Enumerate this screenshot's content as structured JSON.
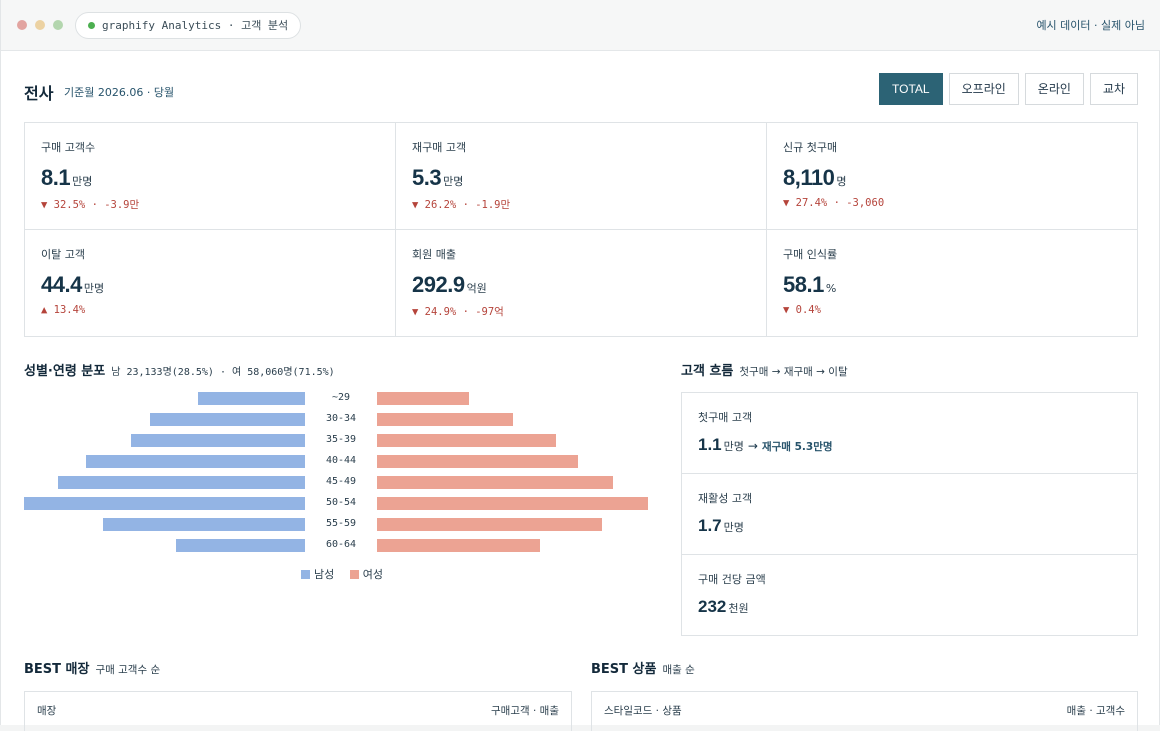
{
  "window": {
    "app_title": "graphify Analytics · 고객 분석",
    "sample_note": "예시 데이터 · 실제 아님"
  },
  "header": {
    "title": "전사",
    "base_month": "기준월 2026.06 · 당월",
    "segments": [
      "TOTAL",
      "오프라인",
      "온라인",
      "교차"
    ],
    "active_segment": "TOTAL"
  },
  "kpis": [
    {
      "label": "구매 고객수",
      "value": "8.1",
      "unit": "만명",
      "delta": "▼ 32.5% · -3.9만"
    },
    {
      "label": "재구매 고객",
      "value": "5.3",
      "unit": "만명",
      "delta": "▼ 26.2% · -1.9만"
    },
    {
      "label": "신규 첫구매",
      "value": "8,110",
      "unit": "명",
      "delta": "▼ 27.4% · -3,060"
    },
    {
      "label": "이탈 고객",
      "value": "44.4",
      "unit": "만명",
      "delta": "▲ 13.4%"
    },
    {
      "label": "회원 매출",
      "value": "292.9",
      "unit": "억원",
      "delta": "▼ 24.9% · -97억"
    },
    {
      "label": "구매 인식률",
      "value": "58.1",
      "unit": "%",
      "delta": "▼ 0.4%"
    }
  ],
  "pyramid": {
    "title": "성별·연령 분포",
    "summary": "남 23,133명(28.5%) · 여 58,060명(71.5%)",
    "legend": {
      "male": "남성",
      "female": "여성"
    },
    "colors": {
      "male": "#93b4e4",
      "female": "#eca393"
    }
  },
  "chart_data": {
    "type": "bar",
    "categories": [
      "~29",
      "30-34",
      "35-39",
      "40-44",
      "45-49",
      "50-54",
      "55-59",
      "60-64"
    ],
    "series": [
      {
        "name": "남성",
        "values": [
          0.38,
          0.55,
          0.62,
          0.78,
          0.88,
          1.0,
          0.72,
          0.46
        ]
      },
      {
        "name": "여성",
        "values": [
          0.34,
          0.5,
          0.66,
          0.74,
          0.87,
          1.0,
          0.83,
          0.6
        ]
      }
    ],
    "orientation": "horizontal-diverging",
    "legend_position": "bottom"
  },
  "flow": {
    "title": "고객 흐름",
    "subtitle": "첫구매 → 재구매 → 이탈",
    "items": [
      {
        "label": "첫구매 고객",
        "value": "1.1",
        "unit": "만명",
        "extra": "재구매 5.3만명"
      },
      {
        "label": "재활성 고객",
        "value": "1.7",
        "unit": "만명"
      },
      {
        "label": "구매 건당 금액",
        "value": "232",
        "unit": "천원"
      }
    ]
  },
  "best_stores": {
    "title": "BEST 매장",
    "subtitle": "구매 고객수 순",
    "col_left": "매장",
    "col_right": "구매고객 · 매출"
  },
  "best_products": {
    "title": "BEST 상품",
    "subtitle": "매출 순",
    "col_left": "스타일코드 · 상품",
    "col_right": "매출 · 고객수"
  }
}
